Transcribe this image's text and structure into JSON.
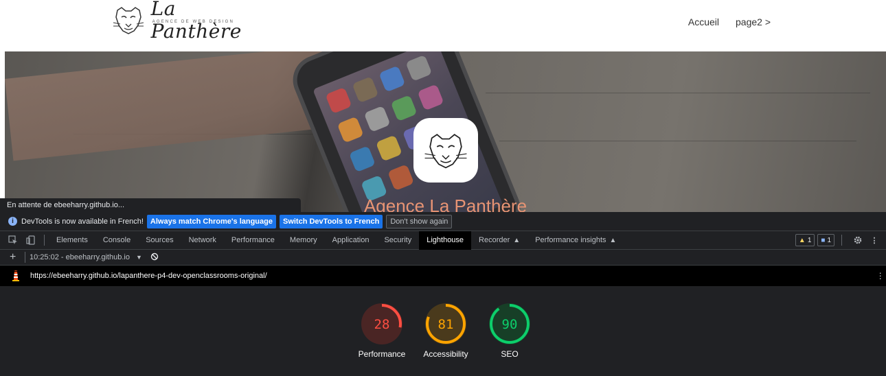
{
  "site": {
    "logo_text": "La Panthère",
    "logo_subtitle": "AGENCE DE WEB DESIGN",
    "nav": [
      "Accueil",
      "page2 >"
    ],
    "hero_title": "Agence La Panthère"
  },
  "status_tooltip": "En attente de ebeeharry.github.io...",
  "devtools": {
    "infobar": {
      "message": "DevTools is now available in French!",
      "buttons": [
        "Always match Chrome's language",
        "Switch DevTools to French",
        "Don't show again"
      ]
    },
    "tabs": [
      {
        "label": "Elements"
      },
      {
        "label": "Console"
      },
      {
        "label": "Sources"
      },
      {
        "label": "Network"
      },
      {
        "label": "Performance"
      },
      {
        "label": "Memory"
      },
      {
        "label": "Application"
      },
      {
        "label": "Security"
      },
      {
        "label": "Lighthouse",
        "active": true
      },
      {
        "label": "Recorder",
        "experimental": true
      },
      {
        "label": "Performance insights",
        "experimental": true
      }
    ],
    "warnings_count": "1",
    "messages_count": "1",
    "report_selector": "10:25:02 - ebeeharry.github.io",
    "url": "https://ebeeharry.github.io/lapanthere-p4-dev-openclassrooms-original/",
    "scores": [
      {
        "label": "Performance",
        "value": 28,
        "color": "#ff4e42",
        "track": "#4a2524"
      },
      {
        "label": "Accessibility",
        "value": 81,
        "color": "#ffa400",
        "track": "#4a3a1c"
      },
      {
        "label": "SEO",
        "value": 90,
        "color": "#0cce6b",
        "track": "#173f27"
      }
    ]
  }
}
